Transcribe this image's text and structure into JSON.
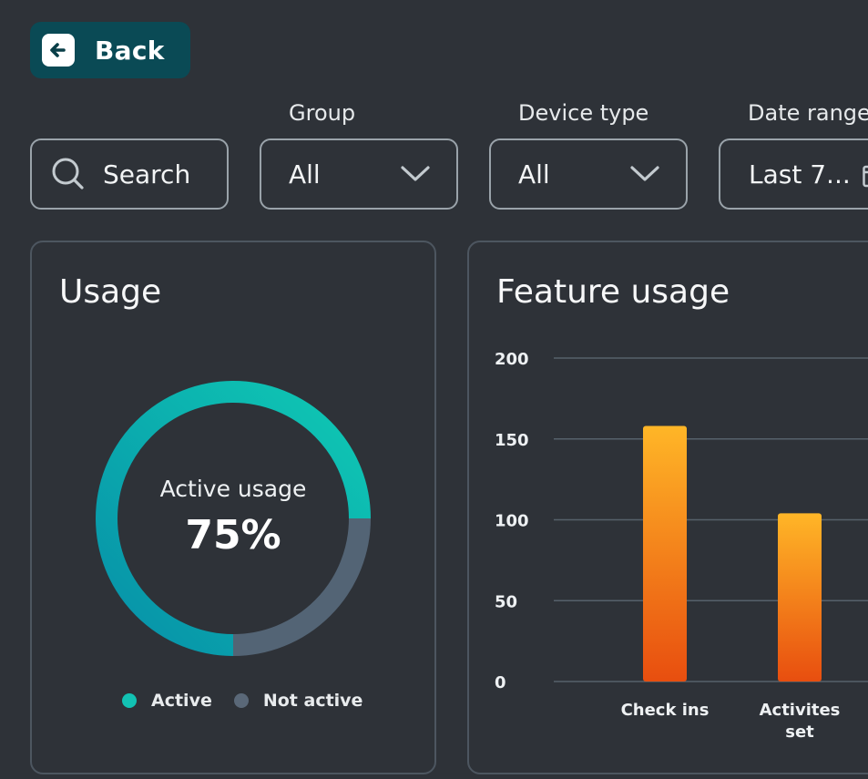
{
  "header": {
    "back_label": "Back"
  },
  "filters": {
    "search_placeholder": "Search",
    "group": {
      "label": "Group",
      "value": "All"
    },
    "device_type": {
      "label": "Device type",
      "value": "All"
    },
    "date_range": {
      "label": "Date range",
      "value": "Last 7..."
    }
  },
  "usage_card": {
    "title": "Usage",
    "center_label": "Active usage",
    "center_value": "75%",
    "active_fraction": 0.75,
    "legend": [
      {
        "label": "Active",
        "color": "#12c2b3"
      },
      {
        "label": "Not active",
        "color": "#5a6878"
      }
    ]
  },
  "feature_card": {
    "title": "Feature usage"
  },
  "chart_data": {
    "type": "bar",
    "categories": [
      "Check ins",
      "Activites set"
    ],
    "values": [
      158,
      104
    ],
    "ylim": [
      0,
      200
    ],
    "yticks": [
      0,
      50,
      100,
      150,
      200
    ],
    "grid": true,
    "bar_color_top": "#ffb627",
    "bar_color_bottom": "#e84e0f"
  }
}
